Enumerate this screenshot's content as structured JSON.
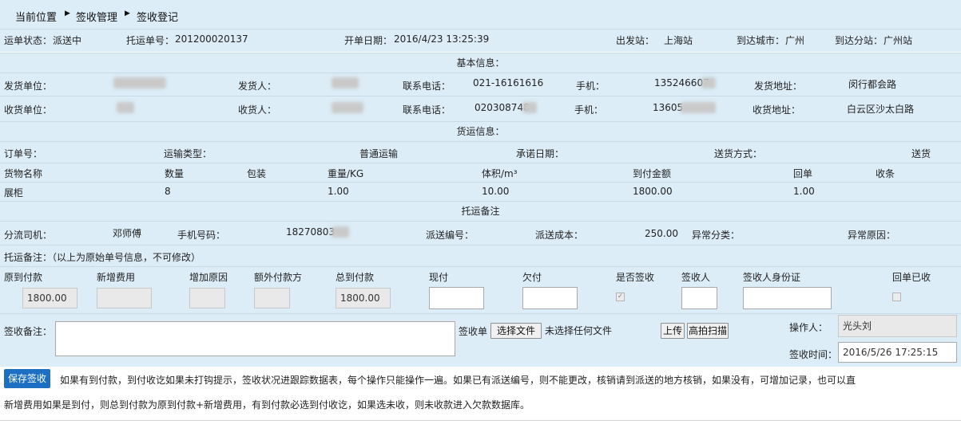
{
  "breadcrumb": {
    "items": [
      "当前位置",
      "签收管理",
      "签收登记"
    ]
  },
  "order": {
    "status_label": "运单状态：",
    "status": "派送中",
    "tracking_label": "托运单号：",
    "tracking": "201200020137",
    "date_label": "开单日期：",
    "date": "2016/4/23 13:25:39",
    "origin_label": "出发站：",
    "origin": "上海站",
    "dest_city_label": "到达城市：",
    "dest_city": "广州",
    "dest_station_label": "到达分站：",
    "dest_station": "广州站"
  },
  "basic": {
    "section_title": "基本信息：",
    "shipper": {
      "unit_label": "发货单位：",
      "person_label": "发货人：",
      "tel_label": "联系电话：",
      "tel": "021-16161616",
      "mobile_label": "手机：",
      "mobile": "135246607",
      "addr_label": "发货地址：",
      "addr": "闵行都会路"
    },
    "receiver": {
      "unit_label": "收货单位：",
      "person_label": "收货人：",
      "tel_label": "联系电话：",
      "tel": "020308748",
      "mobile_label": "手机：",
      "mobile": "13605",
      "addr_label": "收货地址：",
      "addr": "白云区沙太白路"
    }
  },
  "cargo": {
    "section_title": "货运信息：",
    "order_no_label": "订单号：",
    "transport_label": "运输类型：",
    "transport": "普通运输",
    "promise_label": "承诺日期：",
    "delivery_label": "送货方式：",
    "delivery": "送货",
    "headers": [
      "货物名称",
      "数量",
      "包装",
      "重量/KG",
      "体积/m³",
      "到付金额",
      "回单",
      "收条"
    ],
    "row": [
      "展柜",
      "8",
      "",
      "1.00",
      "10.00",
      "1800.00",
      "1.00",
      ""
    ]
  },
  "remarks": {
    "section_title": "托运备注",
    "driver_label": "分流司机：",
    "driver": "邓师傅",
    "phone_label": "手机号码：",
    "phone": "18270803",
    "dispatch_no_label": "派送编号：",
    "dispatch_cost_label": "派送成本：",
    "dispatch_cost": "250.00",
    "exception_type_label": "异常分类：",
    "exception_reason_label": "异常原因：",
    "note": "托运备注：（以上为原始单号信息，不可修改）"
  },
  "payment": {
    "headers": [
      "原到付款",
      "新增费用",
      "增加原因",
      "额外付款方",
      "总到付款",
      "现付",
      "欠付",
      "是否签收",
      "签收人",
      "签收人身份证",
      "回单已收"
    ],
    "original": "1800.00",
    "total": "1800.00"
  },
  "sign": {
    "remark_label": "签收备注：",
    "receipt_label": "签收单",
    "choose_file": "选择文件",
    "no_file": "未选择任何文件",
    "upload": "上传",
    "scan": "高拍扫描",
    "operator_label": "操作人：",
    "operator": "光头刘",
    "time_label": "签收时间：",
    "time": "2016/5/26 17:25:15"
  },
  "footer": {
    "save": "保存签收",
    "tip1": "如果有到付款，到付收讫如果未打钩提示，签收状况进跟踪数据表，每个操作只能操作一遍。如果已有派送编号，则不能更改，核销请到派送的地方核销，如果没有，可增加记录，也可以直",
    "tip2": "新增费用如果是到付，则总到付款为原到付款+新增费用，有到付款必选到付收讫，如果选未收，则未收款进入欠款数据库。"
  },
  "colors": {
    "band": "#dcedf7",
    "save_button": "#1d6fc4"
  }
}
